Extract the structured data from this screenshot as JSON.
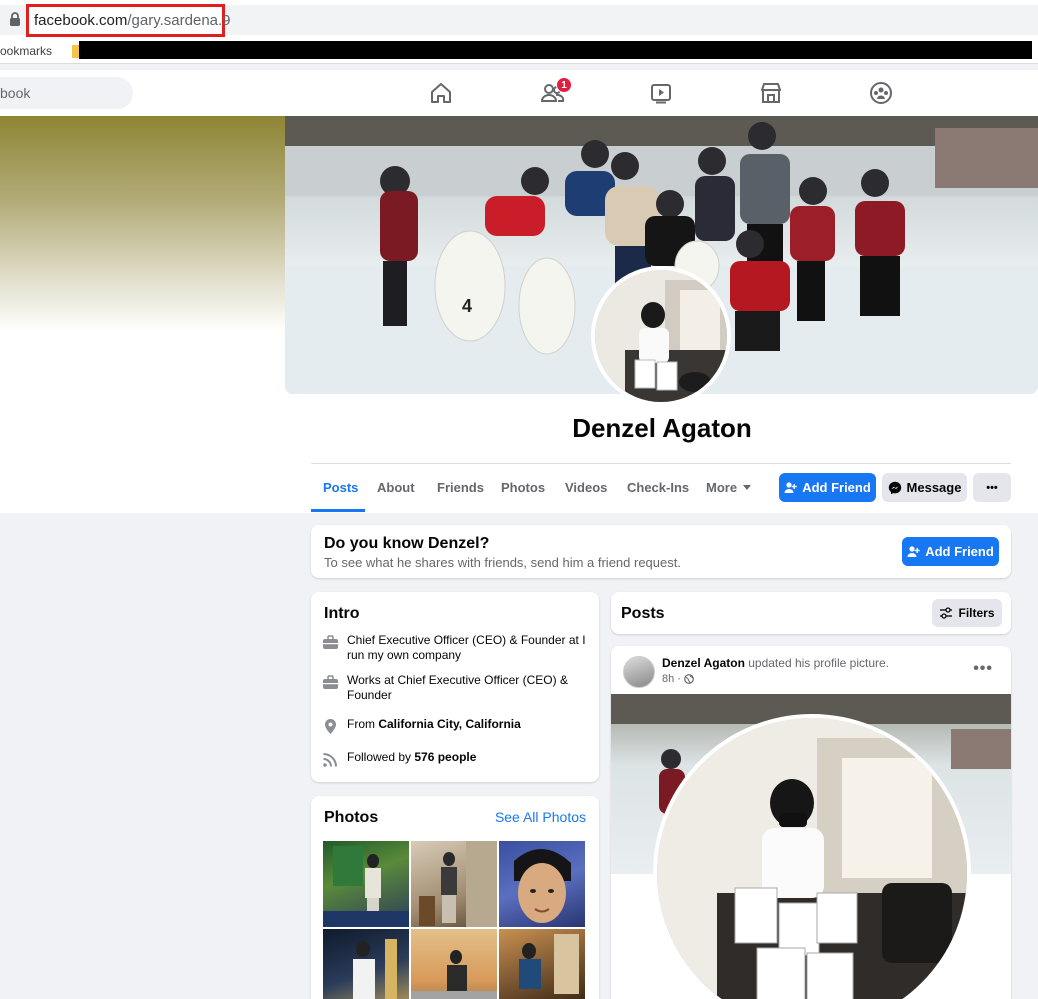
{
  "browser": {
    "url_host": "facebook.com",
    "url_path": "/gary.sardena.9",
    "bookmarks_label": "Bookmarks"
  },
  "header": {
    "search_placeholder": "book",
    "friend_requests_badge": "1",
    "nav_icons": [
      "home-icon",
      "friends-icon",
      "watch-icon",
      "marketplace-icon",
      "groups-icon"
    ]
  },
  "profile": {
    "name": "Denzel Agaton",
    "tabs": [
      "Posts",
      "About",
      "Friends",
      "Photos",
      "Videos",
      "Check-Ins",
      "More"
    ],
    "add_friend_label": "Add Friend",
    "message_label": "Message",
    "more_actions_label": "•••"
  },
  "know_card": {
    "title": "Do you know Denzel?",
    "subtitle": "To see what he shares with friends, send him a friend request.",
    "button": "Add Friend"
  },
  "intro": {
    "title": "Intro",
    "items": [
      {
        "icon": "briefcase-icon",
        "text": "Chief Executive Officer (CEO) & Founder at I run my own company"
      },
      {
        "icon": "briefcase-icon",
        "text": "Works at Chief Executive Officer (CEO) & Founder"
      },
      {
        "icon": "location-pin-icon",
        "prefix": "From ",
        "strong": "California City, California"
      },
      {
        "icon": "rss-icon",
        "prefix": "Followed by ",
        "strong": "576 people"
      }
    ]
  },
  "photos": {
    "title": "Photos",
    "see_all": "See All Photos"
  },
  "posts": {
    "title": "Posts",
    "filters_label": "Filters",
    "post": {
      "author": "Denzel Agaton",
      "action": " updated his profile picture.",
      "time": "8h ·",
      "more": "•••"
    }
  },
  "colors": {
    "brand_blue": "#1877f2",
    "badge_red": "#e41e3f",
    "url_highlight": "#e0201d"
  }
}
